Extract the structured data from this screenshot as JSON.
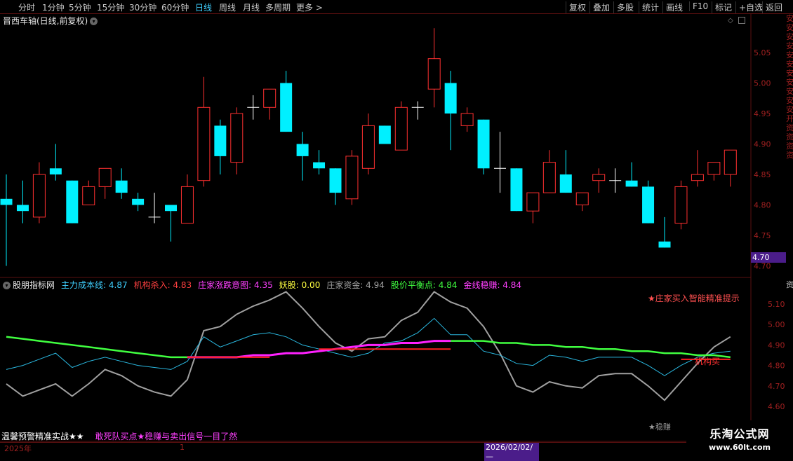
{
  "toolbar": {
    "periods": [
      "分时",
      "1分钟",
      "5分钟",
      "15分钟",
      "30分钟",
      "60分钟",
      "日线",
      "周线",
      "月线",
      "多周期",
      "更多 >"
    ],
    "active_period": "日线",
    "actions": [
      "复权",
      "叠加",
      "多股",
      "统计",
      "画线",
      "F10",
      "标记",
      "+自选",
      "返回"
    ]
  },
  "main": {
    "title": "晋西车轴(日线,前复权)",
    "last_price": "4.70",
    "y_ticks": [
      "5.05",
      "5.00",
      "4.95",
      "4.90",
      "4.85",
      "4.80",
      "4.75",
      "4.70"
    ],
    "candles": [
      {
        "o": 4.81,
        "c": 4.8,
        "h": 4.85,
        "l": 4.7
      },
      {
        "o": 4.8,
        "c": 4.79,
        "h": 4.84,
        "l": 4.77
      },
      {
        "o": 4.78,
        "c": 4.85,
        "h": 4.87,
        "l": 4.77
      },
      {
        "o": 4.86,
        "c": 4.85,
        "h": 4.9,
        "l": 4.84
      },
      {
        "o": 4.84,
        "c": 4.77,
        "h": 4.84,
        "l": 4.77
      },
      {
        "o": 4.8,
        "c": 4.83,
        "h": 4.84,
        "l": 4.8
      },
      {
        "o": 4.83,
        "c": 4.86,
        "h": 4.86,
        "l": 4.81
      },
      {
        "o": 4.84,
        "c": 4.82,
        "h": 4.86,
        "l": 4.81
      },
      {
        "o": 4.81,
        "c": 4.8,
        "h": 4.82,
        "l": 4.79
      },
      {
        "o": 4.78,
        "c": 4.78,
        "h": 4.82,
        "l": 4.77
      },
      {
        "o": 4.8,
        "c": 4.79,
        "h": 4.8,
        "l": 4.74
      },
      {
        "o": 4.77,
        "c": 4.83,
        "h": 4.85,
        "l": 4.77
      },
      {
        "o": 4.84,
        "c": 4.96,
        "h": 5.01,
        "l": 4.83
      },
      {
        "o": 4.93,
        "c": 4.88,
        "h": 4.94,
        "l": 4.85
      },
      {
        "o": 4.87,
        "c": 4.95,
        "h": 4.96,
        "l": 4.85
      },
      {
        "o": 4.96,
        "c": 4.96,
        "h": 4.98,
        "l": 4.94
      },
      {
        "o": 4.96,
        "c": 4.99,
        "h": 4.99,
        "l": 4.94
      },
      {
        "o": 5.0,
        "c": 4.92,
        "h": 5.02,
        "l": 4.92
      },
      {
        "o": 4.9,
        "c": 4.88,
        "h": 4.92,
        "l": 4.84
      },
      {
        "o": 4.87,
        "c": 4.86,
        "h": 4.89,
        "l": 4.85
      },
      {
        "o": 4.86,
        "c": 4.82,
        "h": 4.86,
        "l": 4.8
      },
      {
        "o": 4.81,
        "c": 4.88,
        "h": 4.89,
        "l": 4.8
      },
      {
        "o": 4.86,
        "c": 4.93,
        "h": 4.95,
        "l": 4.85
      },
      {
        "o": 4.93,
        "c": 4.9,
        "h": 4.93,
        "l": 4.9
      },
      {
        "o": 4.89,
        "c": 4.96,
        "h": 4.97,
        "l": 4.89
      },
      {
        "o": 4.96,
        "c": 4.96,
        "h": 4.97,
        "l": 4.94
      },
      {
        "o": 4.99,
        "c": 5.04,
        "h": 5.09,
        "l": 4.96
      },
      {
        "o": 5.0,
        "c": 4.95,
        "h": 5.02,
        "l": 4.89
      },
      {
        "o": 4.93,
        "c": 4.95,
        "h": 4.96,
        "l": 4.92
      },
      {
        "o": 4.94,
        "c": 4.86,
        "h": 4.94,
        "l": 4.85
      },
      {
        "o": 4.86,
        "c": 4.86,
        "h": 4.92,
        "l": 4.82
      },
      {
        "o": 4.86,
        "c": 4.79,
        "h": 4.86,
        "l": 4.79
      },
      {
        "o": 4.79,
        "c": 4.82,
        "h": 4.82,
        "l": 4.77
      },
      {
        "o": 4.82,
        "c": 4.87,
        "h": 4.89,
        "l": 4.82
      },
      {
        "o": 4.85,
        "c": 4.82,
        "h": 4.89,
        "l": 4.82
      },
      {
        "o": 4.8,
        "c": 4.82,
        "h": 4.82,
        "l": 4.79
      },
      {
        "o": 4.84,
        "c": 4.85,
        "h": 4.86,
        "l": 4.82
      },
      {
        "o": 4.84,
        "c": 4.84,
        "h": 4.86,
        "l": 4.82
      },
      {
        "o": 4.84,
        "c": 4.83,
        "h": 4.87,
        "l": 4.83
      },
      {
        "o": 4.83,
        "c": 4.77,
        "h": 4.84,
        "l": 4.77
      },
      {
        "o": 4.74,
        "c": 4.73,
        "h": 4.78,
        "l": 4.73
      },
      {
        "o": 4.77,
        "c": 4.83,
        "h": 4.84,
        "l": 4.76
      },
      {
        "o": 4.84,
        "c": 4.85,
        "h": 4.89,
        "l": 4.83
      },
      {
        "o": 4.85,
        "c": 4.87,
        "h": 4.87,
        "l": 4.84
      },
      {
        "o": 4.85,
        "c": 4.89,
        "h": 4.89,
        "l": 4.83
      }
    ]
  },
  "indicator": {
    "name": "股朋指标网",
    "labels": [
      {
        "text": "主力成本线: 4.87",
        "color": "#3fd0ff"
      },
      {
        "text": "机构杀入: 4.83",
        "color": "#ff4040"
      },
      {
        "text": "庄家涨跌意图: 4.35",
        "color": "#ff40ff"
      },
      {
        "text": "妖股: 0.00",
        "color": "#ffff40"
      },
      {
        "text": "庄家资金: 4.94",
        "color": "#a0a0a0"
      },
      {
        "text": "股价平衡点: 4.84",
        "color": "#40ff40"
      },
      {
        "text": "金线稳赚: 4.84",
        "color": "#ff40ff"
      }
    ],
    "y_ticks": [
      "5.10",
      "5.00",
      "4.90",
      "4.80",
      "4.70",
      "4.60"
    ],
    "annotation_top": "★庄家买入智能精准提示",
    "annotation_buy": "机构买",
    "annotation_wen": "★稳赚",
    "colors": {
      "green": "#40ff40",
      "magenta": "#ff20ff",
      "gray": "#a0a0a0",
      "cyan": "#2ab8e0",
      "red": "#ff2020"
    },
    "gray_line": [
      4.71,
      4.65,
      4.68,
      4.71,
      4.65,
      4.71,
      4.78,
      4.75,
      4.7,
      4.67,
      4.65,
      4.73,
      4.97,
      4.99,
      5.05,
      5.09,
      5.12,
      5.16,
      5.08,
      4.99,
      4.91,
      4.87,
      4.93,
      4.94,
      5.02,
      5.06,
      5.16,
      5.11,
      5.08,
      4.99,
      4.86,
      4.7,
      4.67,
      4.72,
      4.7,
      4.69,
      4.75,
      4.76,
      4.76,
      4.7,
      4.63,
      4.72,
      4.81,
      4.89,
      4.94
    ],
    "cyan_line": [
      4.78,
      4.8,
      4.83,
      4.86,
      4.79,
      4.82,
      4.84,
      4.82,
      4.8,
      4.79,
      4.78,
      4.82,
      4.94,
      4.89,
      4.92,
      4.95,
      4.96,
      4.94,
      4.9,
      4.88,
      4.86,
      4.84,
      4.86,
      4.91,
      4.92,
      4.96,
      5.03,
      4.95,
      4.95,
      4.87,
      4.85,
      4.81,
      4.8,
      4.85,
      4.84,
      4.82,
      4.84,
      4.84,
      4.84,
      4.8,
      4.75,
      4.8,
      4.84,
      4.86,
      4.87
    ],
    "green_line": [
      4.94,
      4.93,
      4.92,
      4.91,
      4.9,
      4.89,
      4.88,
      4.87,
      4.86,
      4.85,
      4.84,
      4.84,
      4.84,
      4.84,
      4.84,
      4.85,
      4.85,
      4.86,
      4.86,
      4.87,
      4.88,
      4.89,
      4.9,
      4.9,
      4.91,
      4.91,
      4.92,
      4.92,
      4.92,
      4.92,
      4.91,
      4.91,
      4.9,
      4.9,
      4.89,
      4.89,
      4.88,
      4.88,
      4.87,
      4.87,
      4.86,
      4.86,
      4.85,
      4.85,
      4.84
    ],
    "magenta_segment": {
      "from": 11,
      "to": 27
    },
    "red_segments": [
      {
        "from": 11,
        "to": 16,
        "v": 4.84
      },
      {
        "from": 19,
        "to": 27,
        "v": 4.88
      },
      {
        "from": 41,
        "to": 44,
        "v": 4.83
      }
    ]
  },
  "footer": {
    "title": "温馨预警精准实战★★",
    "subtitle": "敢死队买点★稳赚与卖出信号一目了然",
    "year": "2025年",
    "month": "1",
    "cursor_date": "2026/02/02/—",
    "watermark_1": "乐淘公式网",
    "watermark_2": "www.60lt.com"
  },
  "side": {
    "right_text": "安安安安安安安安安安安开资资资资",
    "right_text2": "资"
  }
}
